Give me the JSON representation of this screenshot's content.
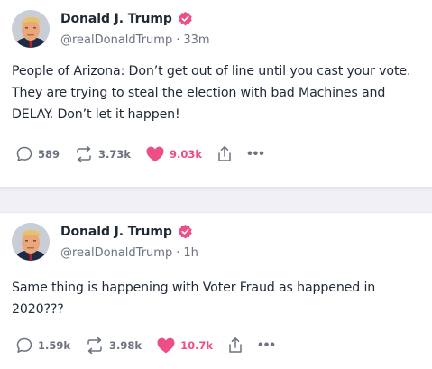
{
  "colors": {
    "verified": "#ec4f87",
    "like": "#ec4f87",
    "muted": "#6b7280",
    "text": "#1f2937",
    "separator": "#f1f1f5"
  },
  "posts": [
    {
      "author_name": "Donald J. Trump",
      "handle": "@realDonaldTrump",
      "separator": "·",
      "time": "33m",
      "text": "People of Arizona: Don’t get out of line until you cast your vote.\nThey are trying to steal the election with bad Machines and\nDELAY. Don’t let it happen!",
      "replies": "589",
      "reposts": "3.73k",
      "likes": "9.03k",
      "icons": [
        "reply-icon",
        "repost-icon",
        "heart-icon",
        "share-icon",
        "more-icon"
      ]
    },
    {
      "author_name": "Donald J. Trump",
      "handle": "@realDonaldTrump",
      "separator": "·",
      "time": "1h",
      "text": "Same thing is happening with Voter Fraud as happened in\n2020???",
      "replies": "1.59k",
      "reposts": "3.98k",
      "likes": "10.7k",
      "icons": [
        "reply-icon",
        "repost-icon",
        "heart-icon",
        "share-icon",
        "more-icon"
      ]
    }
  ]
}
